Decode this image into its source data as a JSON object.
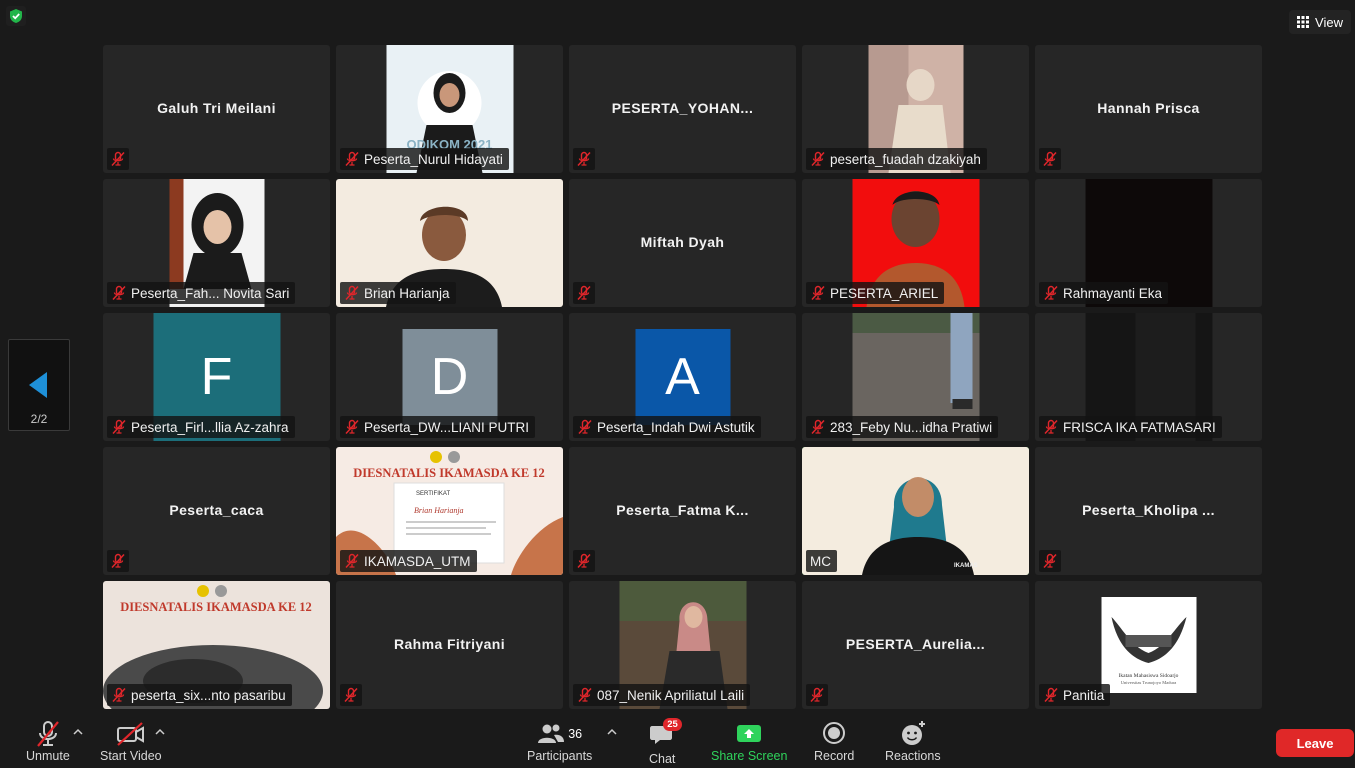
{
  "top": {
    "view_label": "View"
  },
  "pager": {
    "page": "2/2"
  },
  "tiles": [
    {
      "name": "Galuh Tri Meilani",
      "video": false
    },
    {
      "name": "Peserta_Nurul Hidayati",
      "video": true
    },
    {
      "name": "PESERTA_YOHAN...",
      "video": false
    },
    {
      "name": "peserta_fuadah dzakiyah",
      "video": true
    },
    {
      "name": "Hannah Prisca",
      "video": false
    },
    {
      "name": "Peserta_Fah... Novita Sari",
      "video": true
    },
    {
      "name": "Brian Harianja",
      "video": true
    },
    {
      "name": "Miftah Dyah",
      "video": false
    },
    {
      "name": "PESERTA_ARIEL",
      "video": true
    },
    {
      "name": "Rahmayanti Eka",
      "video": true
    },
    {
      "name": "Peserta_Firl...llia Az-zahra",
      "video": false,
      "letter": "F"
    },
    {
      "name": "Peserta_DW...LIANI PUTRI",
      "video": false,
      "letter": "D"
    },
    {
      "name": "Peserta_Indah Dwi Astutik",
      "video": false,
      "letter": "A"
    },
    {
      "name": "283_Feby Nu...idha Pratiwi",
      "video": true
    },
    {
      "name": "FRISCA IKA FATMASARI",
      "video": true
    },
    {
      "name": "Peserta_caca",
      "video": false
    },
    {
      "name": "IKAMASDA_UTM",
      "video": true
    },
    {
      "name": "Peserta_Fatma K...",
      "video": false
    },
    {
      "name": "MC",
      "video": true,
      "active": true
    },
    {
      "name": "Peserta_Kholipa ...",
      "video": false
    },
    {
      "name": "peserta_six...nto pasaribu",
      "video": true
    },
    {
      "name": "Rahma Fitriyani",
      "video": false
    },
    {
      "name": "087_Nenik Apriliatul Laili",
      "video": true
    },
    {
      "name": "PESERTA_Aurelia...",
      "video": false
    },
    {
      "name": "Panitia",
      "video": true
    }
  ],
  "banner": {
    "title": "DIESNATALIS IKAMASDA KE 12",
    "cert_title": "SERTIFIKAT",
    "cert_name": "Brian Harianja",
    "odikom": "ODIKOM 2021",
    "logo_text": "Ikatan Mahasiswa Sidoarjo",
    "logo_sub": "Universitas Trunojoyo Madura",
    "shirt_text": "IKAMAS"
  },
  "toolbar": {
    "unmute": "Unmute",
    "start_video": "Start Video",
    "participants": "Participants",
    "participants_count": "36",
    "chat": "Chat",
    "chat_badge": "25",
    "share_screen": "Share Screen",
    "record": "Record",
    "reactions": "Reactions",
    "leave": "Leave"
  },
  "colors": {
    "active_border": "#2ac34a",
    "leave": "#e02828",
    "share_green": "#2fd35c",
    "muted_red": "#e0262b",
    "letter_F": "#1c6e7a",
    "letter_D": "#7f8e99",
    "letter_A": "#0a57a8"
  }
}
